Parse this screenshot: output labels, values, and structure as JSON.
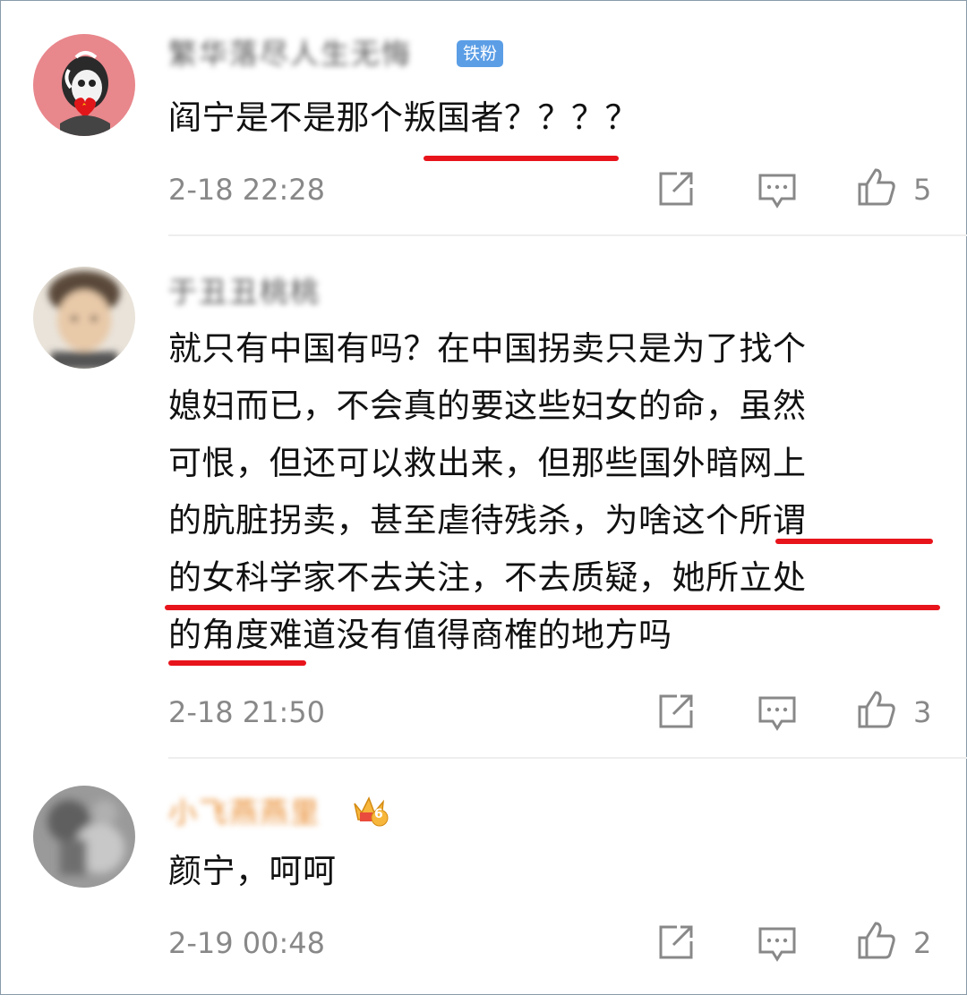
{
  "comments": [
    {
      "username": "繁华落尽人生无悔",
      "badge": "铁粉",
      "text_lines": [
        "阎宁是不是那个叛国者？？？？"
      ],
      "time": "2-18 22:28",
      "likes": "5"
    },
    {
      "username": "于丑丑桃桃",
      "text_lines": [
        "就只有中国有吗？在中国拐卖只是为了找个",
        "媳妇而已，不会真的要这些妇女的命，虽然",
        "可恨，但还可以救出来，但那些国外暗网上",
        "的肮脏拐卖，甚至虐待残杀，为啥这个所谓",
        "的女科学家不去关注，不去质疑，她所立处",
        "的角度难道没有值得商榷的地方吗"
      ],
      "time": "2-18 21:50",
      "likes": "3"
    },
    {
      "username": "小飞燕燕里",
      "badge_level": "6",
      "text_lines": [
        "颜宁，呵呵"
      ],
      "time": "2-19 00:48",
      "likes": "2"
    }
  ],
  "icons": {
    "share": "share-icon",
    "reply": "comment-icon",
    "like": "thumbs-up-icon"
  },
  "colors": {
    "underline": "#e8141c",
    "fan_badge": "#5b9ee6",
    "meta_text": "#888888"
  }
}
